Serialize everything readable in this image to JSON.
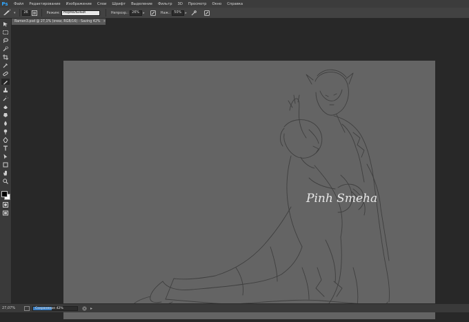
{
  "app": {
    "logo": "Ps"
  },
  "menu": [
    "Файл",
    "Редактирование",
    "Изображение",
    "Слои",
    "Шрифт",
    "Выделение",
    "Фильтр",
    "3D",
    "Просмотр",
    "Окно",
    "Справка"
  ],
  "options": {
    "brush_size": "26",
    "mode_label": "Режим:",
    "mode_value": "Нормальный",
    "opacity_label": "Непрозр.:",
    "opacity_value": "26%",
    "flow_label": "Наж.:",
    "flow_value": "50%"
  },
  "document": {
    "tab_title": "Ramen3.psd @ 27,1% (очки, RGB/16) - Saving 42%",
    "tab_close": "×",
    "signature": "Pinh Smeha"
  },
  "tools": [
    "move-icon",
    "marquee-icon",
    "lasso-icon",
    "quick-select-icon",
    "crop-icon",
    "eyedropper-icon",
    "healing-icon",
    "brush-icon",
    "stamp-icon",
    "history-brush-icon",
    "eraser-icon",
    "gradient-icon",
    "blur-icon",
    "dodge-icon",
    "pen-icon",
    "type-icon",
    "path-select-icon",
    "shape-icon",
    "hand-icon",
    "zoom-icon"
  ],
  "status": {
    "zoom": "27,07%",
    "progress_text": "Сохранение 42%",
    "progress": 0.42
  },
  "colors": {
    "accent": "#3d7fc2",
    "logo": "#31a8ff",
    "canvas": "#646464",
    "workspace": "#282828"
  }
}
